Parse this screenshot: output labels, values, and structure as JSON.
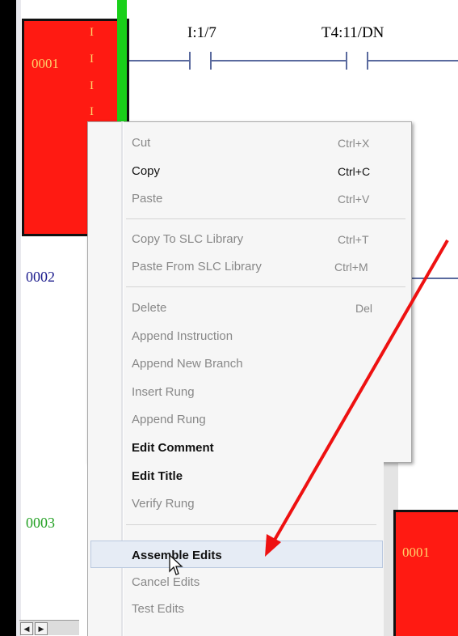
{
  "ladder": {
    "rung1": {
      "number": "0001",
      "marks": [
        "I",
        "I",
        "I",
        "I"
      ],
      "contacts": [
        "I:1/7",
        "T4:11/DN"
      ]
    },
    "rung2_number": "0002",
    "rung3_number": "0003",
    "second_window_rung": "0001",
    "scroll_left": "◀",
    "scroll_right": "▶"
  },
  "menu": {
    "items": [
      {
        "label": "Cut",
        "shortcut": "Ctrl+X"
      },
      {
        "label": "Copy",
        "shortcut": "Ctrl+C"
      },
      {
        "label": "Paste",
        "shortcut": "Ctrl+V"
      },
      {
        "label": "Copy To SLC Library",
        "shortcut": "Ctrl+T"
      },
      {
        "label": "Paste From SLC Library",
        "shortcut": "Ctrl+M"
      },
      {
        "label": "Delete",
        "shortcut": "Del"
      },
      {
        "label": "Append Instruction"
      },
      {
        "label": "Append New Branch"
      },
      {
        "label": "Insert Rung"
      },
      {
        "label": "Append Rung"
      },
      {
        "label": "Edit Comment"
      },
      {
        "label": "Edit Title"
      },
      {
        "label": "Verify Rung"
      },
      {
        "label": "Assemble Edits"
      },
      {
        "label": "Cancel Edits"
      },
      {
        "label": "Test Edits"
      }
    ]
  },
  "colors": {
    "rung_marker": "#ff1a12",
    "annotation_arrow": "#ee1111",
    "power_rail": "#19d019",
    "rung2_number": "#1a1a8c",
    "rung3_number": "#22a022"
  }
}
